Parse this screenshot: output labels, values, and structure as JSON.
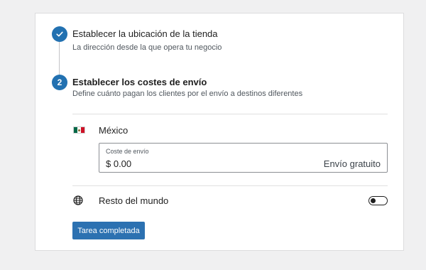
{
  "steps": [
    {
      "status": "completed",
      "icon": "check-icon",
      "title": "Establecer la ubicación de la tienda",
      "description": "La dirección desde la que opera tu negocio"
    },
    {
      "status": "current",
      "number": "2",
      "title": "Establecer los costes de envío",
      "description": "Define cuánto pagan los clientes por el envío a destinos diferentes"
    }
  ],
  "regions": {
    "mexico": {
      "icon": "mexico-flag-icon",
      "label": "México",
      "field_label": "Coste de envío",
      "value": "$ 0.00",
      "suffix": "Envío gratuito"
    },
    "rest": {
      "icon": "globe-icon",
      "label": "Resto del mundo",
      "toggle_on": false
    }
  },
  "complete_button": "Tarea completada",
  "colors": {
    "accent": "#2271b1",
    "background": "#f0f0f1",
    "card": "#ffffff"
  }
}
